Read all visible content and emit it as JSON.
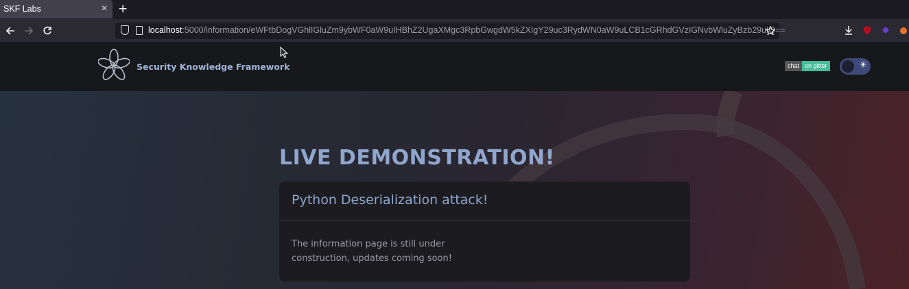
{
  "browser": {
    "tab_title": "SKF Labs",
    "tab_close": "✕",
    "new_tab": "+",
    "url_host": "localhost",
    "url_rest": ":5000/information/eWFtbDogVGhlIGluZm9ybWF0aW9uIHBhZ2UgaXMgc3RpbGwgdW5kZXIgY29uc3RydWN0aW9uLCB1cGRhdGVzIGNvbWluZyBzb29uIQ=="
  },
  "header": {
    "brand": "Security Knowledge Framework",
    "badge_left": "chat",
    "badge_right": "on gitter"
  },
  "hero": {
    "heading": "LIVE DEMONSTRATION!",
    "card_title": "Python Deserialization attack!",
    "card_body": "The information page is still under construction, updates coming soon!"
  },
  "colors": {
    "accent": "#90a6cd",
    "badge_green": "#46bc99"
  }
}
